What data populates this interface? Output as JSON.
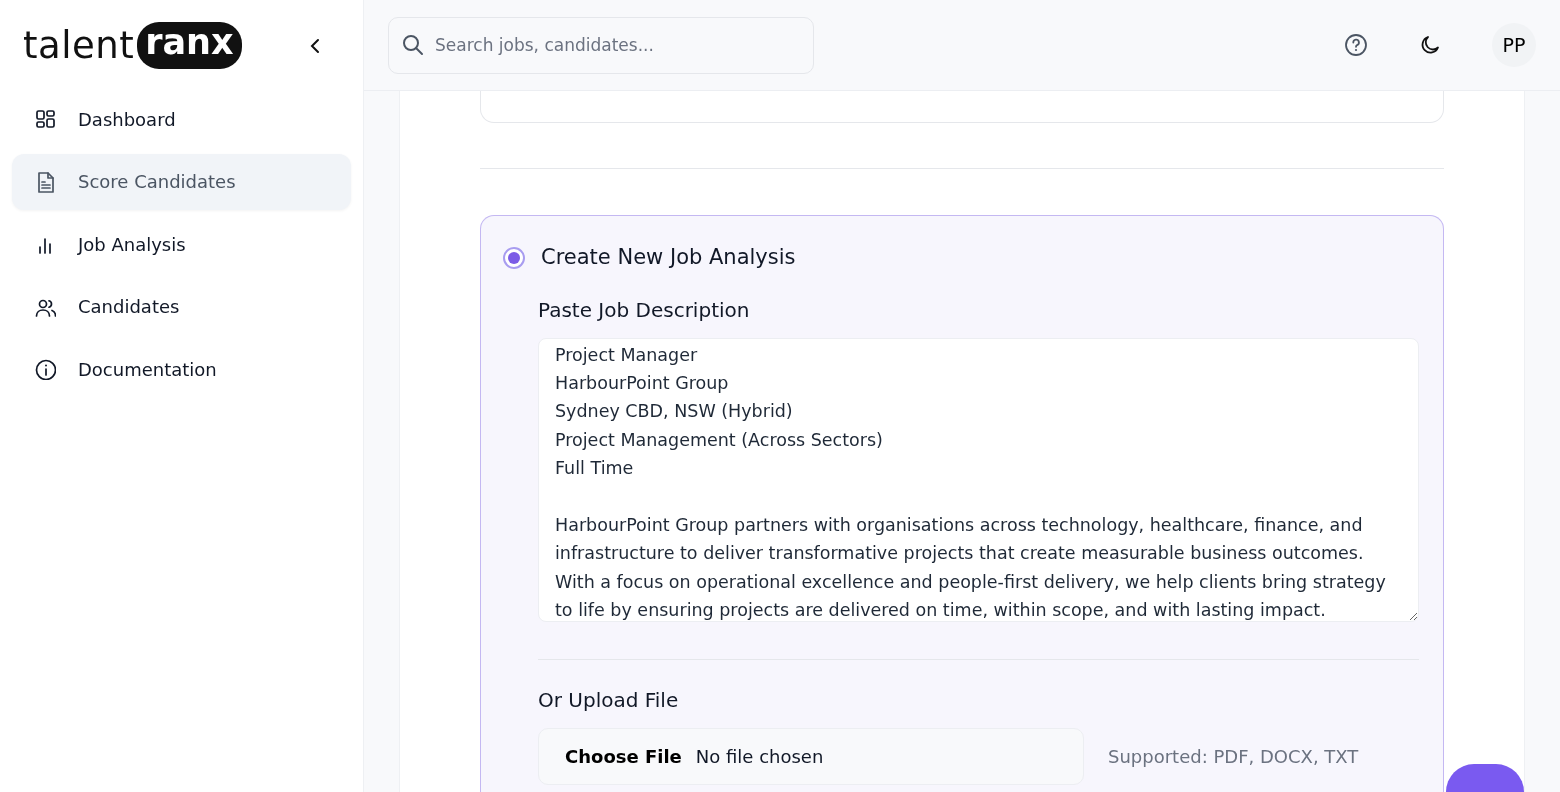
{
  "logo": {
    "word": "talent",
    "pill": "ranx"
  },
  "sidebar": {
    "items": [
      {
        "label": "Dashboard",
        "selected": false
      },
      {
        "label": "Score Candidates",
        "selected": true
      },
      {
        "label": "Job Analysis",
        "selected": false
      },
      {
        "label": "Candidates",
        "selected": false
      },
      {
        "label": "Documentation",
        "selected": false
      }
    ]
  },
  "header": {
    "search": {
      "placeholder": "Search jobs, candidates..."
    },
    "avatar": "PP"
  },
  "option": {
    "label": "Create New Job Analysis",
    "selected": true,
    "paste": {
      "heading": "Paste Job Description",
      "header_lines": [
        "Project Manager",
        "HarbourPoint Group",
        "Sydney CBD, NSW (Hybrid)",
        "Project Management (Across Sectors)",
        "Full Time"
      ],
      "body_lines": [
        "HarbourPoint Group partners with organisations across technology, healthcare, finance, and",
        "infrastructure to deliver transformative projects that create measurable business outcomes.",
        "With a focus on operational excellence and people-first delivery, we help clients bring strategy",
        "to life by ensuring projects are delivered on time, within scope, and with lasting impact."
      ]
    },
    "upload": {
      "heading": "Or Upload File",
      "button": "Choose File",
      "status": "No file chosen",
      "hint": "Supported: PDF, DOCX, TXT"
    }
  }
}
